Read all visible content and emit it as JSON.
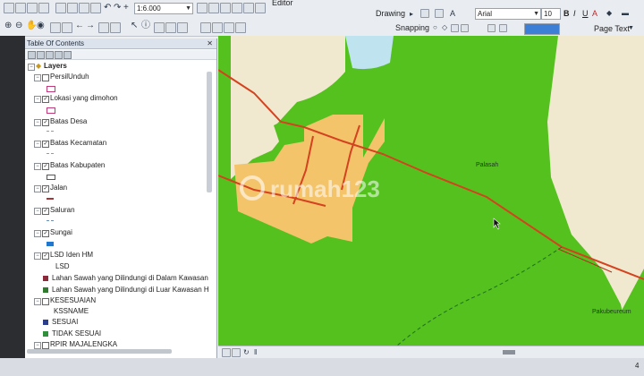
{
  "toolbar": {
    "scale_value": "1:6.000",
    "editor_label": "Editor",
    "drawing_label": "Drawing",
    "font_name": "Arial",
    "font_size": "10",
    "snapping_label": "Snapping",
    "page_text_label": "Page Text",
    "bold": "B",
    "italic": "I",
    "underline": "U",
    "font_color": "A"
  },
  "toc": {
    "title": "Table Of Contents",
    "root": "Layers",
    "layers": [
      {
        "name": "PersilUnduh",
        "checked": false,
        "swatch": "#c0397a"
      },
      {
        "name": "Lokasi yang dimohon",
        "checked": true,
        "swatch": "#c0397a"
      },
      {
        "name": "Batas Desa",
        "checked": true,
        "swatch": "#999999"
      },
      {
        "name": "Batas Kecamatan",
        "checked": true,
        "swatch": "#999999"
      },
      {
        "name": "Batas Kabupaten",
        "checked": true,
        "swatch": "#555555"
      },
      {
        "name": "Jalan",
        "checked": true,
        "swatch": "#a33636"
      },
      {
        "name": "Saluran",
        "checked": true,
        "swatch": "#6b8fb3"
      },
      {
        "name": "Sungai",
        "checked": true,
        "swatch": "#2277cc"
      },
      {
        "name": "LSD Iden HM",
        "checked": true,
        "swatch": null
      }
    ],
    "lsd_field": "LSD",
    "lsd_items": [
      {
        "label": "Lahan Sawah yang Dilindungi di Dalam Kawasan",
        "color": "#8b2a3a"
      },
      {
        "label": "Lahan Sawah yang Dilindungi di Luar Kawasan H",
        "color": "#2f7a2f"
      }
    ],
    "kesesuaian": {
      "name": "KESESUAIAN",
      "field": "KSSNAME",
      "items": [
        {
          "label": "SESUAI",
          "color": "#2c3f8f"
        },
        {
          "label": "TIDAK SESUAI",
          "color": "#2f8f3a"
        }
      ]
    },
    "last_layer": "RPIR MAJALENGKA"
  },
  "map": {
    "label_palasah": "Palasah",
    "label_pakubeureum": "Pakubeureum",
    "watermark": "rumah123",
    "colors": {
      "green": "#54c11f",
      "cream": "#f1e9cf",
      "orange": "#f4c46b",
      "water": "#bfe3ef",
      "road": "#d4421f"
    }
  },
  "status": {
    "page_number": "4"
  }
}
